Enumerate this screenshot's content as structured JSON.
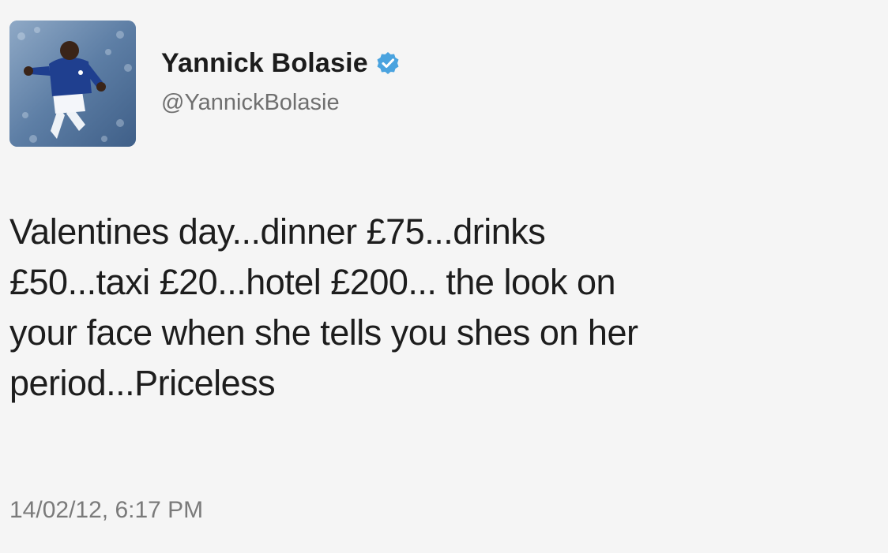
{
  "tweet": {
    "author": {
      "display_name": "Yannick Bolasie",
      "handle": "@YannickBolasie",
      "verified": true,
      "avatar_icon": "profile-photo",
      "verified_icon": "verified-badge-icon"
    },
    "text_lines": [
      "Valentines day...dinner £75...drinks",
      "£50...taxi £20...hotel £200... the look on",
      "your face when she tells you shes on her",
      "period...Priceless"
    ],
    "timestamp": "14/02/12, 6:17 PM"
  },
  "colors": {
    "background": "#f5f5f5",
    "text": "#1d1d1d",
    "secondary_text": "#6f6f6f",
    "verified_blue": "#4aa3df"
  }
}
